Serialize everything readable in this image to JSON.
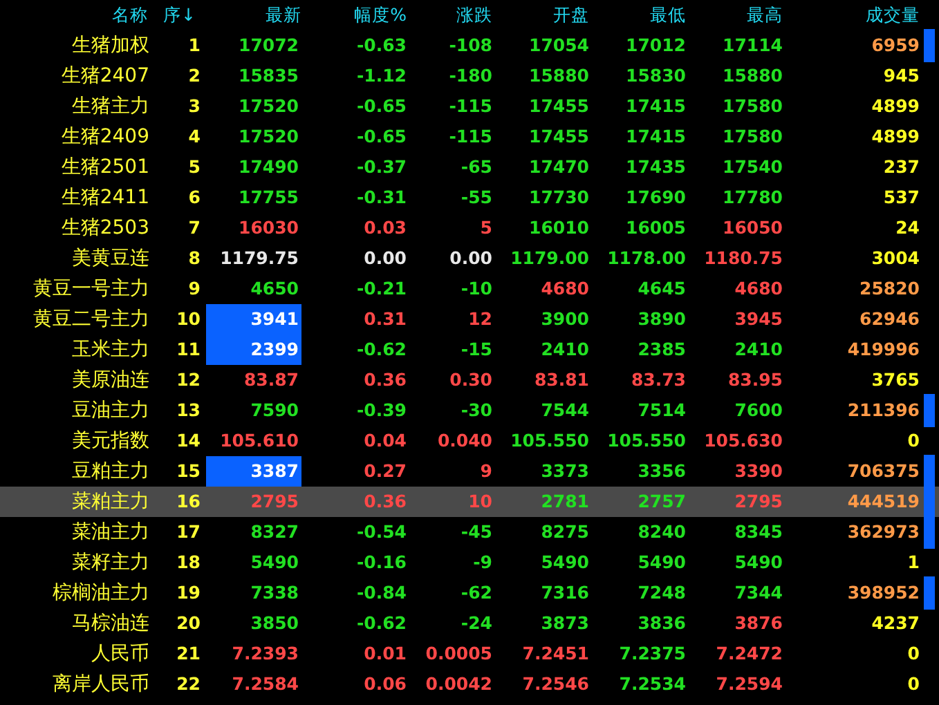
{
  "columns": [
    "名称",
    "序↓",
    "最新",
    "幅度%",
    "涨跌",
    "开盘",
    "最低",
    "最高",
    "成交量"
  ],
  "rows": [
    {
      "name": "生猪加权",
      "seq": "1",
      "cells": [
        {
          "text": "17072",
          "color": "#22e022"
        },
        {
          "text": "-0.63",
          "color": "#22e022"
        },
        {
          "text": "-108",
          "color": "#22e022"
        },
        {
          "text": "17054",
          "color": "#22e022"
        },
        {
          "text": "17012",
          "color": "#22e022"
        },
        {
          "text": "17114",
          "color": "#22e022"
        }
      ],
      "volume": {
        "text": "6959",
        "large": true
      },
      "marker": true,
      "selected": false
    },
    {
      "name": "生猪2407",
      "seq": "2",
      "cells": [
        {
          "text": "15835",
          "color": "#22e022"
        },
        {
          "text": "-1.12",
          "color": "#22e022"
        },
        {
          "text": "-180",
          "color": "#22e022"
        },
        {
          "text": "15880",
          "color": "#22e022"
        },
        {
          "text": "15830",
          "color": "#22e022"
        },
        {
          "text": "15880",
          "color": "#22e022"
        }
      ],
      "volume": {
        "text": "945",
        "large": false
      },
      "marker": false,
      "selected": false
    },
    {
      "name": "生猪主力",
      "seq": "3",
      "cells": [
        {
          "text": "17520",
          "color": "#22e022"
        },
        {
          "text": "-0.65",
          "color": "#22e022"
        },
        {
          "text": "-115",
          "color": "#22e022"
        },
        {
          "text": "17455",
          "color": "#22e022"
        },
        {
          "text": "17415",
          "color": "#22e022"
        },
        {
          "text": "17580",
          "color": "#22e022"
        }
      ],
      "volume": {
        "text": "4899",
        "large": false
      },
      "marker": false,
      "selected": false
    },
    {
      "name": "生猪2409",
      "seq": "4",
      "cells": [
        {
          "text": "17520",
          "color": "#22e022"
        },
        {
          "text": "-0.65",
          "color": "#22e022"
        },
        {
          "text": "-115",
          "color": "#22e022"
        },
        {
          "text": "17455",
          "color": "#22e022"
        },
        {
          "text": "17415",
          "color": "#22e022"
        },
        {
          "text": "17580",
          "color": "#22e022"
        }
      ],
      "volume": {
        "text": "4899",
        "large": false
      },
      "marker": false,
      "selected": false
    },
    {
      "name": "生猪2501",
      "seq": "5",
      "cells": [
        {
          "text": "17490",
          "color": "#22e022"
        },
        {
          "text": "-0.37",
          "color": "#22e022"
        },
        {
          "text": "-65",
          "color": "#22e022"
        },
        {
          "text": "17470",
          "color": "#22e022"
        },
        {
          "text": "17435",
          "color": "#22e022"
        },
        {
          "text": "17540",
          "color": "#22e022"
        }
      ],
      "volume": {
        "text": "237",
        "large": false
      },
      "marker": false,
      "selected": false
    },
    {
      "name": "生猪2411",
      "seq": "6",
      "cells": [
        {
          "text": "17755",
          "color": "#22e022"
        },
        {
          "text": "-0.31",
          "color": "#22e022"
        },
        {
          "text": "-55",
          "color": "#22e022"
        },
        {
          "text": "17730",
          "color": "#22e022"
        },
        {
          "text": "17690",
          "color": "#22e022"
        },
        {
          "text": "17780",
          "color": "#22e022"
        }
      ],
      "volume": {
        "text": "537",
        "large": false
      },
      "marker": false,
      "selected": false
    },
    {
      "name": "生猪2503",
      "seq": "7",
      "cells": [
        {
          "text": "16030",
          "color": "#ff4848"
        },
        {
          "text": "0.03",
          "color": "#ff4848"
        },
        {
          "text": "5",
          "color": "#ff4848"
        },
        {
          "text": "16010",
          "color": "#22e022"
        },
        {
          "text": "16005",
          "color": "#22e022"
        },
        {
          "text": "16050",
          "color": "#ff4848"
        }
      ],
      "volume": {
        "text": "24",
        "large": false
      },
      "marker": false,
      "selected": false
    },
    {
      "name": "美黄豆连",
      "seq": "8",
      "cells": [
        {
          "text": "1179.75",
          "color": "#e8e8e8"
        },
        {
          "text": "0.00",
          "color": "#e8e8e8"
        },
        {
          "text": "0.00",
          "color": "#e8e8e8"
        },
        {
          "text": "1179.00",
          "color": "#22e022"
        },
        {
          "text": "1178.00",
          "color": "#22e022"
        },
        {
          "text": "1180.75",
          "color": "#ff4848"
        }
      ],
      "volume": {
        "text": "3004",
        "large": false
      },
      "marker": false,
      "selected": false
    },
    {
      "name": "黄豆一号主力",
      "seq": "9",
      "cells": [
        {
          "text": "4650",
          "color": "#22e022"
        },
        {
          "text": "-0.21",
          "color": "#22e022"
        },
        {
          "text": "-10",
          "color": "#22e022"
        },
        {
          "text": "4680",
          "color": "#ff4848"
        },
        {
          "text": "4645",
          "color": "#22e022"
        },
        {
          "text": "4680",
          "color": "#ff4848"
        }
      ],
      "volume": {
        "text": "25820",
        "large": true
      },
      "marker": false,
      "selected": false
    },
    {
      "name": "黄豆二号主力",
      "seq": "10",
      "cells": [
        {
          "text": "3941",
          "flash": true
        },
        {
          "text": "0.31",
          "color": "#ff4848"
        },
        {
          "text": "12",
          "color": "#ff4848"
        },
        {
          "text": "3900",
          "color": "#22e022"
        },
        {
          "text": "3890",
          "color": "#22e022"
        },
        {
          "text": "3945",
          "color": "#ff4848"
        }
      ],
      "volume": {
        "text": "62946",
        "large": true
      },
      "marker": false,
      "selected": false
    },
    {
      "name": "玉米主力",
      "seq": "11",
      "cells": [
        {
          "text": "2399",
          "flash": true
        },
        {
          "text": "-0.62",
          "color": "#22e022"
        },
        {
          "text": "-15",
          "color": "#22e022"
        },
        {
          "text": "2410",
          "color": "#22e022"
        },
        {
          "text": "2385",
          "color": "#22e022"
        },
        {
          "text": "2410",
          "color": "#22e022"
        }
      ],
      "volume": {
        "text": "419996",
        "large": true
      },
      "marker": false,
      "selected": false
    },
    {
      "name": "美原油连",
      "seq": "12",
      "cells": [
        {
          "text": "83.87",
          "color": "#ff4848"
        },
        {
          "text": "0.36",
          "color": "#ff4848"
        },
        {
          "text": "0.30",
          "color": "#ff4848"
        },
        {
          "text": "83.81",
          "color": "#ff4848"
        },
        {
          "text": "83.73",
          "color": "#ff4848"
        },
        {
          "text": "83.95",
          "color": "#ff4848"
        }
      ],
      "volume": {
        "text": "3765",
        "large": false
      },
      "marker": false,
      "selected": false
    },
    {
      "name": "豆油主力",
      "seq": "13",
      "cells": [
        {
          "text": "7590",
          "color": "#22e022"
        },
        {
          "text": "-0.39",
          "color": "#22e022"
        },
        {
          "text": "-30",
          "color": "#22e022"
        },
        {
          "text": "7544",
          "color": "#22e022"
        },
        {
          "text": "7514",
          "color": "#22e022"
        },
        {
          "text": "7600",
          "color": "#22e022"
        }
      ],
      "volume": {
        "text": "211396",
        "large": true
      },
      "marker": true,
      "selected": false
    },
    {
      "name": "美元指数",
      "seq": "14",
      "cells": [
        {
          "text": "105.610",
          "color": "#ff4848"
        },
        {
          "text": "0.04",
          "color": "#ff4848"
        },
        {
          "text": "0.040",
          "color": "#ff4848"
        },
        {
          "text": "105.550",
          "color": "#22e022"
        },
        {
          "text": "105.550",
          "color": "#22e022"
        },
        {
          "text": "105.630",
          "color": "#ff4848"
        }
      ],
      "volume": {
        "text": "0",
        "large": false
      },
      "marker": false,
      "selected": false
    },
    {
      "name": "豆粕主力",
      "seq": "15",
      "cells": [
        {
          "text": "3387",
          "flash": true
        },
        {
          "text": "0.27",
          "color": "#ff4848"
        },
        {
          "text": "9",
          "color": "#ff4848"
        },
        {
          "text": "3373",
          "color": "#22e022"
        },
        {
          "text": "3356",
          "color": "#22e022"
        },
        {
          "text": "3390",
          "color": "#ff4848"
        }
      ],
      "volume": {
        "text": "706375",
        "large": true
      },
      "marker": true,
      "selected": false
    },
    {
      "name": "菜粕主力",
      "seq": "16",
      "cells": [
        {
          "text": "2795",
          "color": "#ff4848"
        },
        {
          "text": "0.36",
          "color": "#ff4848"
        },
        {
          "text": "10",
          "color": "#ff4848"
        },
        {
          "text": "2781",
          "color": "#22e022"
        },
        {
          "text": "2757",
          "color": "#22e022"
        },
        {
          "text": "2795",
          "color": "#ff4848"
        }
      ],
      "volume": {
        "text": "444519",
        "large": true
      },
      "marker": true,
      "selected": true
    },
    {
      "name": "菜油主力",
      "seq": "17",
      "cells": [
        {
          "text": "8327",
          "color": "#22e022"
        },
        {
          "text": "-0.54",
          "color": "#22e022"
        },
        {
          "text": "-45",
          "color": "#22e022"
        },
        {
          "text": "8275",
          "color": "#22e022"
        },
        {
          "text": "8240",
          "color": "#22e022"
        },
        {
          "text": "8345",
          "color": "#22e022"
        }
      ],
      "volume": {
        "text": "362973",
        "large": true
      },
      "marker": true,
      "selected": false
    },
    {
      "name": "菜籽主力",
      "seq": "18",
      "cells": [
        {
          "text": "5490",
          "color": "#22e022"
        },
        {
          "text": "-0.16",
          "color": "#22e022"
        },
        {
          "text": "-9",
          "color": "#22e022"
        },
        {
          "text": "5490",
          "color": "#22e022"
        },
        {
          "text": "5490",
          "color": "#22e022"
        },
        {
          "text": "5490",
          "color": "#22e022"
        }
      ],
      "volume": {
        "text": "1",
        "large": false
      },
      "marker": false,
      "selected": false
    },
    {
      "name": "棕榈油主力",
      "seq": "19",
      "cells": [
        {
          "text": "7338",
          "color": "#22e022"
        },
        {
          "text": "-0.84",
          "color": "#22e022"
        },
        {
          "text": "-62",
          "color": "#22e022"
        },
        {
          "text": "7316",
          "color": "#22e022"
        },
        {
          "text": "7248",
          "color": "#22e022"
        },
        {
          "text": "7344",
          "color": "#22e022"
        }
      ],
      "volume": {
        "text": "398952",
        "large": true
      },
      "marker": true,
      "selected": false
    },
    {
      "name": "马棕油连",
      "seq": "20",
      "cells": [
        {
          "text": "3850",
          "color": "#22e022"
        },
        {
          "text": "-0.62",
          "color": "#22e022"
        },
        {
          "text": "-24",
          "color": "#22e022"
        },
        {
          "text": "3873",
          "color": "#22e022"
        },
        {
          "text": "3836",
          "color": "#22e022"
        },
        {
          "text": "3876",
          "color": "#ff4848"
        }
      ],
      "volume": {
        "text": "4237",
        "large": false
      },
      "marker": false,
      "selected": false
    },
    {
      "name": "人民币",
      "seq": "21",
      "cells": [
        {
          "text": "7.2393",
          "color": "#ff4848"
        },
        {
          "text": "0.01",
          "color": "#ff4848"
        },
        {
          "text": "0.0005",
          "color": "#ff4848"
        },
        {
          "text": "7.2451",
          "color": "#ff4848"
        },
        {
          "text": "7.2375",
          "color": "#22e022"
        },
        {
          "text": "7.2472",
          "color": "#ff4848"
        }
      ],
      "volume": {
        "text": "0",
        "large": false
      },
      "marker": false,
      "selected": false
    },
    {
      "name": "离岸人民币",
      "seq": "22",
      "cells": [
        {
          "text": "7.2584",
          "color": "#ff4848"
        },
        {
          "text": "0.06",
          "color": "#ff4848"
        },
        {
          "text": "0.0042",
          "color": "#ff4848"
        },
        {
          "text": "7.2546",
          "color": "#ff4848"
        },
        {
          "text": "7.2534",
          "color": "#22e022"
        },
        {
          "text": "7.2594",
          "color": "#ff4848"
        }
      ],
      "volume": {
        "text": "0",
        "large": false
      },
      "marker": false,
      "selected": false
    }
  ]
}
